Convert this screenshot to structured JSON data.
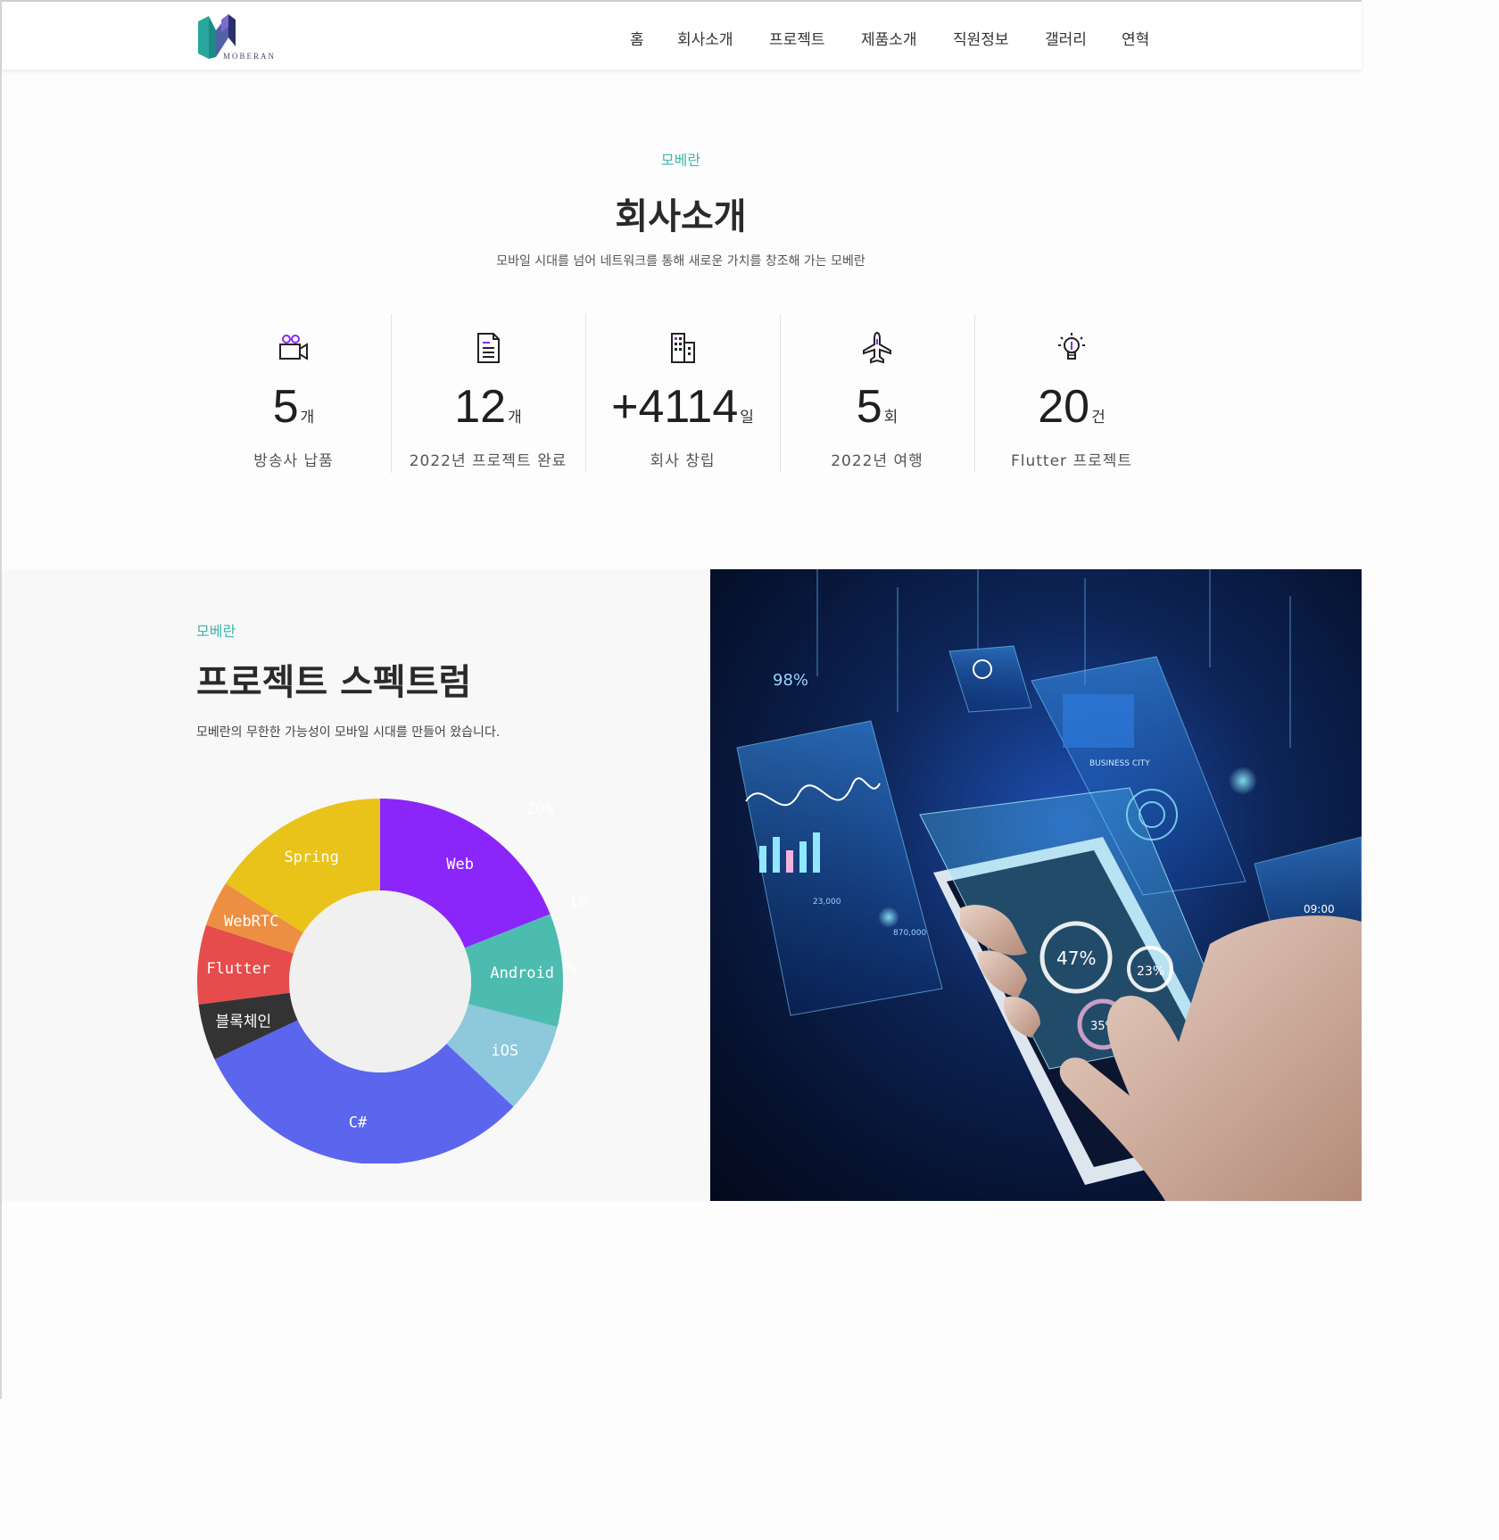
{
  "header": {
    "logo_text": "MOBERAN",
    "nav": [
      {
        "label": "홈"
      },
      {
        "label": "회사소개"
      },
      {
        "label": "프로젝트"
      },
      {
        "label": "제품소개"
      },
      {
        "label": "직원정보"
      },
      {
        "label": "갤러리"
      },
      {
        "label": "연혁"
      }
    ]
  },
  "intro": {
    "eyebrow": "모베란",
    "title": "회사소개",
    "subtitle": "모바일 시대를 넘어 네트워크를 통해 새로운 가치를 창조해 가는 모베란",
    "stats": [
      {
        "icon": "video-camera-icon",
        "value": "5",
        "unit": "개",
        "label": "방송사 납품"
      },
      {
        "icon": "document-icon",
        "value": "12",
        "unit": "개",
        "label": "2022년 프로젝트 완료"
      },
      {
        "icon": "building-icon",
        "value": "+4114",
        "unit": "일",
        "label": "회사 창립"
      },
      {
        "icon": "airplane-icon",
        "value": "5",
        "unit": "회",
        "label": "2022년 여행"
      },
      {
        "icon": "lightbulb-icon",
        "value": "20",
        "unit": "건",
        "label": "Flutter 프로젝트"
      }
    ]
  },
  "spectrum": {
    "eyebrow": "모베란",
    "title": "프로젝트 스펙트럼",
    "subtitle": "모베란의 무한한 가능성이 모바일 시대를 만들어 왔습니다.",
    "colors": {
      "accent": "#3cb6a8"
    }
  },
  "hero": {
    "image": "hand-holding-smartphone-with-holographic-ui-screens",
    "texts": {
      "pct_a": "98%",
      "pct_b": "47%",
      "pct_c": "23%",
      "pct_d": "35%",
      "city": "BUSINESS CITY",
      "num_a": "23,000",
      "num_b": "870,000",
      "time": "09:00"
    }
  },
  "chart_data": {
    "type": "pie",
    "donut": true,
    "categories": [
      "Web",
      "Android",
      "iOS",
      "C#",
      "블록체인",
      "Flutter",
      "WebRTC",
      "Spring"
    ],
    "values": [
      19,
      10,
      8,
      31,
      5,
      7,
      4,
      16
    ],
    "colors": [
      "#8b26fb",
      "#4dbcb0",
      "#8dc8dd",
      "#5b65ee",
      "#333333",
      "#e64c4c",
      "#ed8f42",
      "#e9c31a"
    ],
    "radial_ticks": [
      "20%",
      "10%",
      "0%"
    ]
  }
}
